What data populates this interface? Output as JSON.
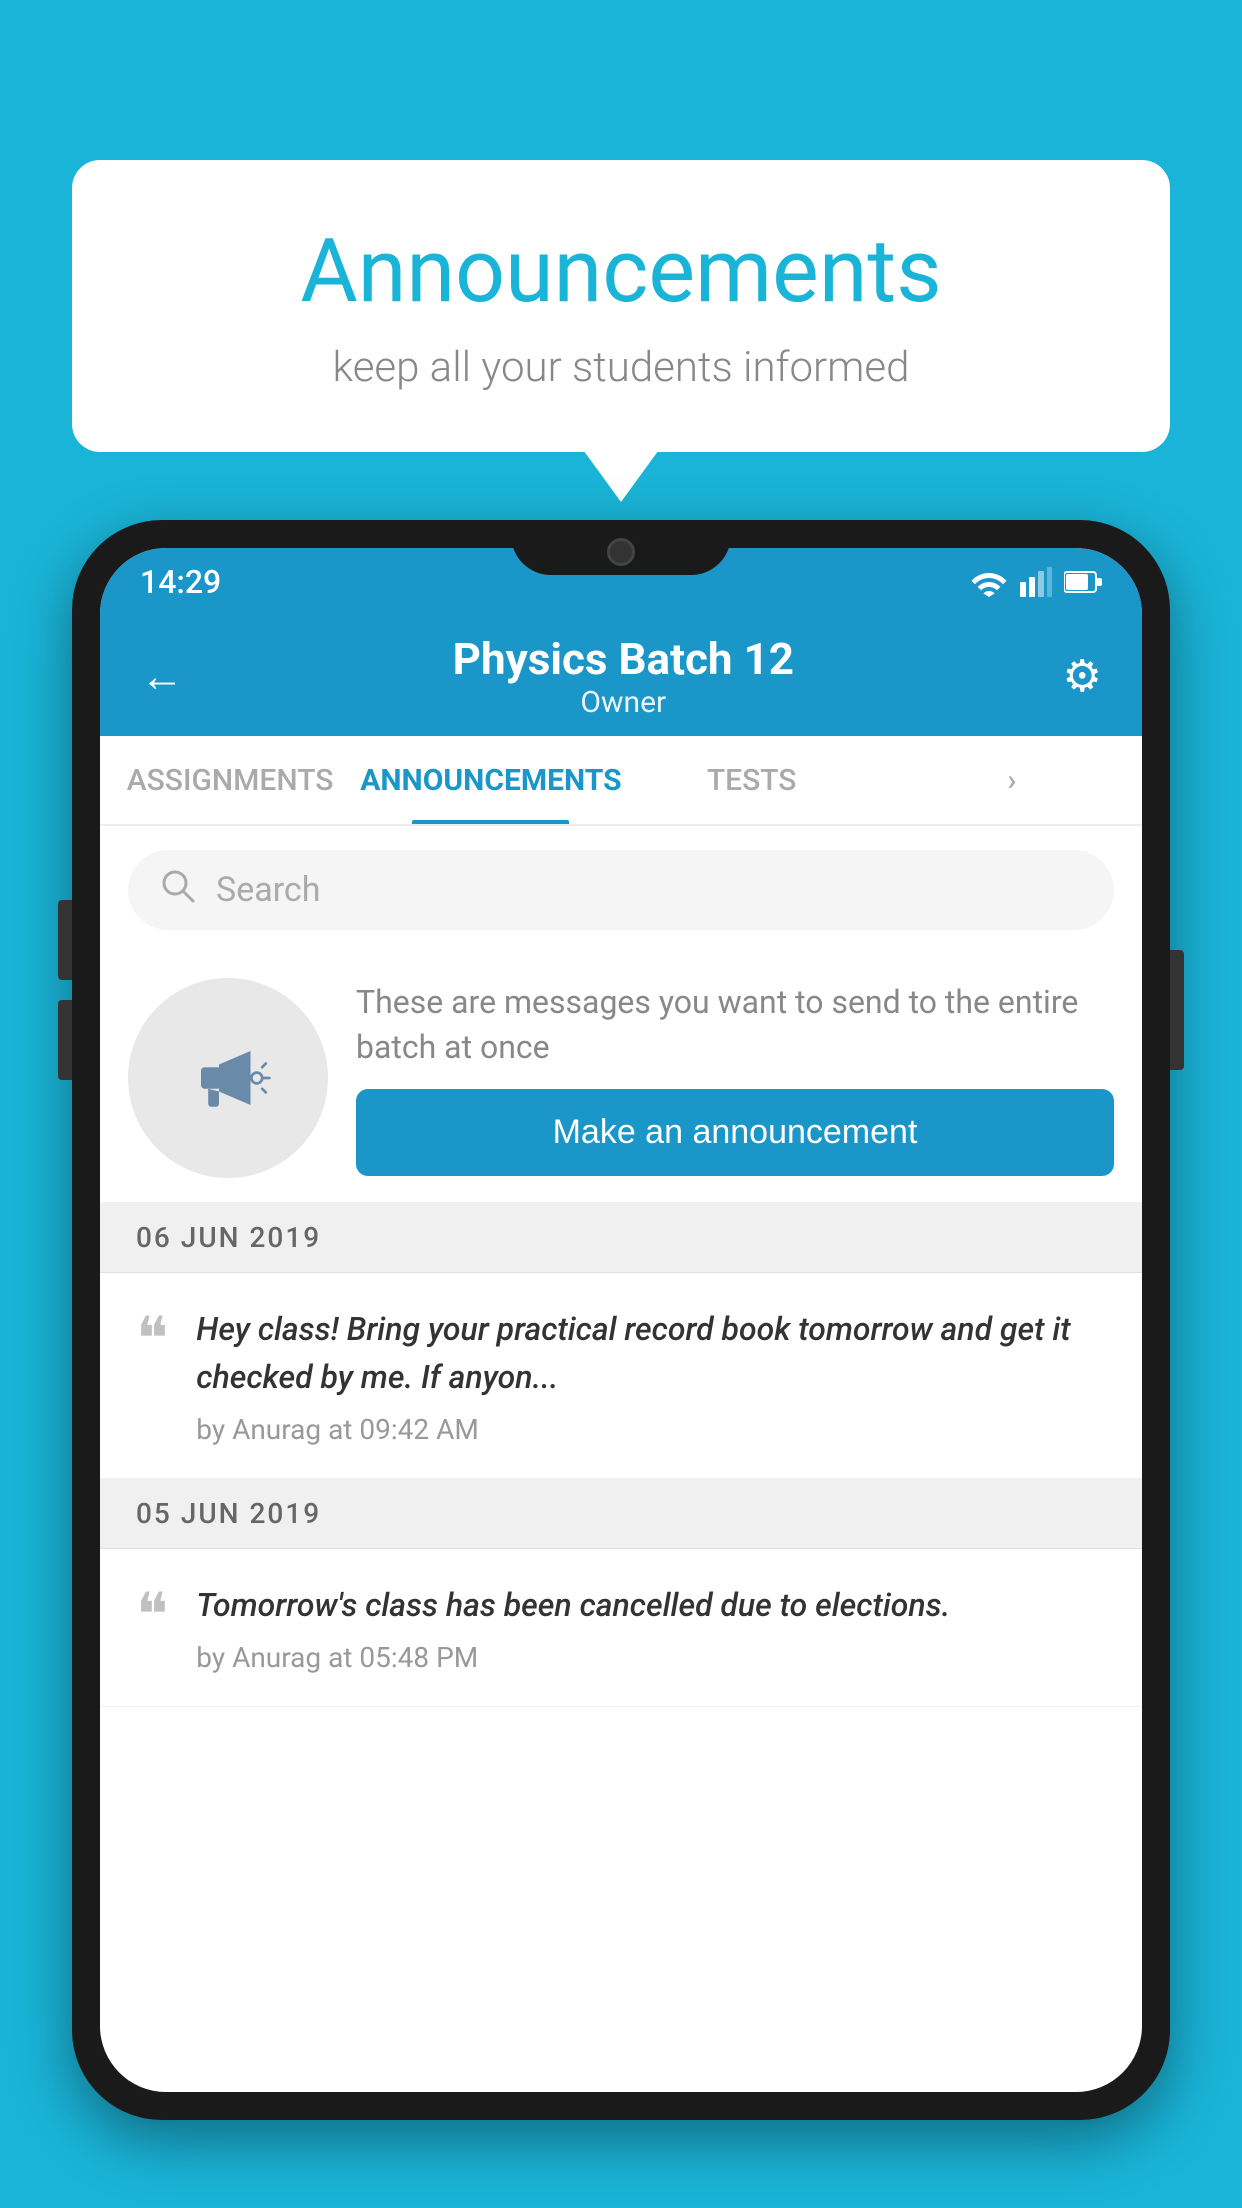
{
  "background_color": "#1ab4d8",
  "speech_bubble": {
    "title": "Announcements",
    "subtitle": "keep all your students informed"
  },
  "status_bar": {
    "time": "14:29"
  },
  "header": {
    "title": "Physics Batch 12",
    "subtitle": "Owner",
    "back_label": "←",
    "gear_label": "⚙"
  },
  "tabs": [
    {
      "label": "ASSIGNMENTS",
      "active": false
    },
    {
      "label": "ANNOUNCEMENTS",
      "active": true
    },
    {
      "label": "TESTS",
      "active": false
    },
    {
      "label": "›",
      "active": false
    }
  ],
  "search": {
    "placeholder": "Search"
  },
  "promo": {
    "text": "These are messages you want to send to the entire batch at once",
    "button_label": "Make an announcement"
  },
  "announcements": [
    {
      "date": "06  JUN  2019",
      "text": "Hey class! Bring your practical record book tomorrow and get it checked by me. If anyon...",
      "meta": "by Anurag at 09:42 AM"
    },
    {
      "date": "05  JUN  2019",
      "text": "Tomorrow's class has been cancelled due to elections.",
      "meta": "by Anurag at 05:48 PM"
    }
  ]
}
